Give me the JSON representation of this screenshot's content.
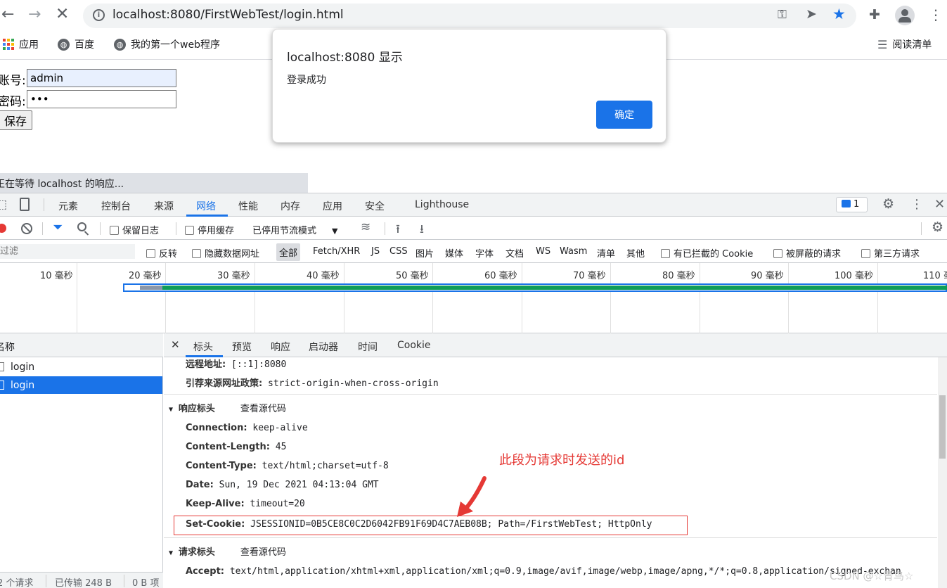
{
  "browser": {
    "url": "localhost:8080/FirstWebTest/login.html",
    "bookmarks": [
      "应用",
      "百度",
      "我的第一个web程序"
    ],
    "reading_list": "阅读清单"
  },
  "page": {
    "account_label": "账号:",
    "account_value": "admin",
    "password_label": "密码:",
    "password_value": "•••",
    "save_button": "保存"
  },
  "status_text": "正在等待 localhost 的响应...",
  "dialog": {
    "title": "localhost:8080 显示",
    "message": "登录成功",
    "ok": "确定"
  },
  "devtools": {
    "tabs": [
      "元素",
      "控制台",
      "来源",
      "网络",
      "性能",
      "内存",
      "应用",
      "安全",
      "Lighthouse"
    ],
    "active_tab": "网络",
    "issues_count": "1",
    "toolbar": {
      "preserve_log": "保留日志",
      "disable_cache": "停用缓存",
      "throttle": "已停用节流模式"
    },
    "filter": {
      "placeholder": "过滤",
      "invert": "反转",
      "hide_data_urls": "隐藏数据网址",
      "types": [
        "全部",
        "Fetch/XHR",
        "JS",
        "CSS",
        "图片",
        "媒体",
        "字体",
        "文档",
        "WS",
        "Wasm",
        "清单",
        "其他"
      ],
      "blocked_cookies": "有已拦截的 Cookie",
      "blocked_requests": "被屏蔽的请求",
      "third_party": "第三方请求"
    },
    "timeline_ticks": [
      "10 毫秒",
      "20 毫秒",
      "30 毫秒",
      "40 毫秒",
      "50 毫秒",
      "60 毫秒",
      "70 毫秒",
      "80 毫秒",
      "90 毫秒",
      "100 毫秒",
      "110 毫"
    ],
    "name_header": "名称",
    "requests": [
      "login",
      "login"
    ],
    "detail_tabs": [
      "标头",
      "预览",
      "响应",
      "启动器",
      "时间",
      "Cookie"
    ],
    "remote_address_label": "远程地址:",
    "remote_address_value": "[::1]:8080",
    "referrer_label": "引荐来源网址政策:",
    "referrer_value": "strict-origin-when-cross-origin",
    "response_headers_title": "响应标头",
    "view_source": "查看源代码",
    "response_headers": [
      {
        "k": "Connection:",
        "v": "keep-alive"
      },
      {
        "k": "Content-Length:",
        "v": "45"
      },
      {
        "k": "Content-Type:",
        "v": "text/html;charset=utf-8"
      },
      {
        "k": "Date:",
        "v": "Sun, 19 Dec 2021 04:13:04 GMT"
      },
      {
        "k": "Keep-Alive:",
        "v": "timeout=20"
      },
      {
        "k": "Set-Cookie:",
        "v": "JSESSIONID=0B5CE8C0C2D6042FB91F69D4C7AEB08B; Path=/FirstWebTest; HttpOnly"
      }
    ],
    "request_headers_title": "请求标头",
    "accept_label": "Accept:",
    "accept_value": "text/html,application/xhtml+xml,application/xml;q=0.9,image/avif,image/webp,image/apng,*/*;q=0.8,application/signed-exchan",
    "summary": [
      "2 个请求",
      "已传输 248 B",
      "0 B 项"
    ]
  },
  "annotation": "此段为请求时发送的id",
  "watermark": "CSDN @☆青鸟☆",
  "colors": {
    "accent": "#1a73e8",
    "annotation": "#e53935"
  }
}
